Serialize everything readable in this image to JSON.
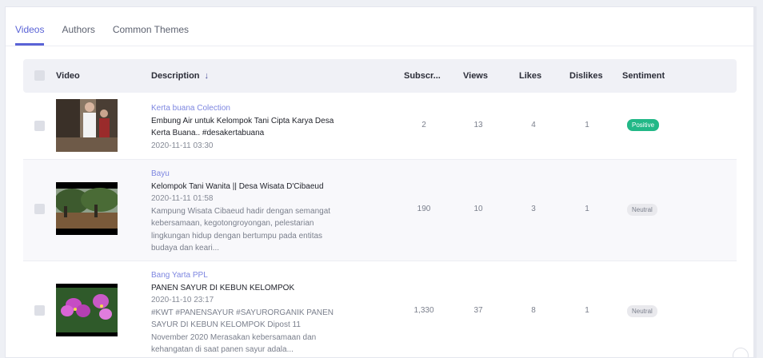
{
  "tabs": [
    {
      "label": "Videos",
      "active": true
    },
    {
      "label": "Authors",
      "active": false
    },
    {
      "label": "Common Themes",
      "active": false
    }
  ],
  "table": {
    "headers": {
      "video": "Video",
      "description": "Description",
      "sort_icon": "↓",
      "subscribers": "Subscr...",
      "views": "Views",
      "likes": "Likes",
      "dislikes": "Dislikes",
      "sentiment": "Sentiment"
    },
    "rows": [
      {
        "author": "Kerta buana Colection",
        "title": "Embung Air untuk Kelompok Tani Cipta Karya Desa Kerta Buana.. #desakertabuana",
        "date": "2020-11-11 03:30",
        "text": "",
        "subscribers": "2",
        "views": "13",
        "likes": "4",
        "dislikes": "1",
        "sentiment": "Positive"
      },
      {
        "author": "Bayu",
        "title": "Kelompok Tani Wanita || Desa Wisata D'Cibaeud",
        "date": "2020-11-11 01:58",
        "text": "Kampung Wisata Cibaeud hadir dengan semangat kebersamaan, kegotongroyongan, pelestarian lingkungan hidup dengan bertumpu pada entitas budaya dan keari...",
        "subscribers": "190",
        "views": "10",
        "likes": "3",
        "dislikes": "1",
        "sentiment": "Neutral"
      },
      {
        "author": "Bang Yarta PPL",
        "title": "PANEN SAYUR DI KEBUN KELOMPOK",
        "date": "2020-11-10 23:17",
        "text": "#KWT #PANENSAYUR #SAYURORGANIK PANEN SAYUR DI KEBUN KELOMPOK Dipost 11 November 2020 Merasakan kebersamaan dan kehangatan di saat panen sayur adala...",
        "subscribers": "1,330",
        "views": "37",
        "likes": "8",
        "dislikes": "1",
        "sentiment": "Neutral"
      }
    ]
  },
  "colors": {
    "accent": "#5a63d6",
    "author_link": "#7d86e0",
    "positive": "#22b887",
    "neutral": "#e9e9ed"
  }
}
